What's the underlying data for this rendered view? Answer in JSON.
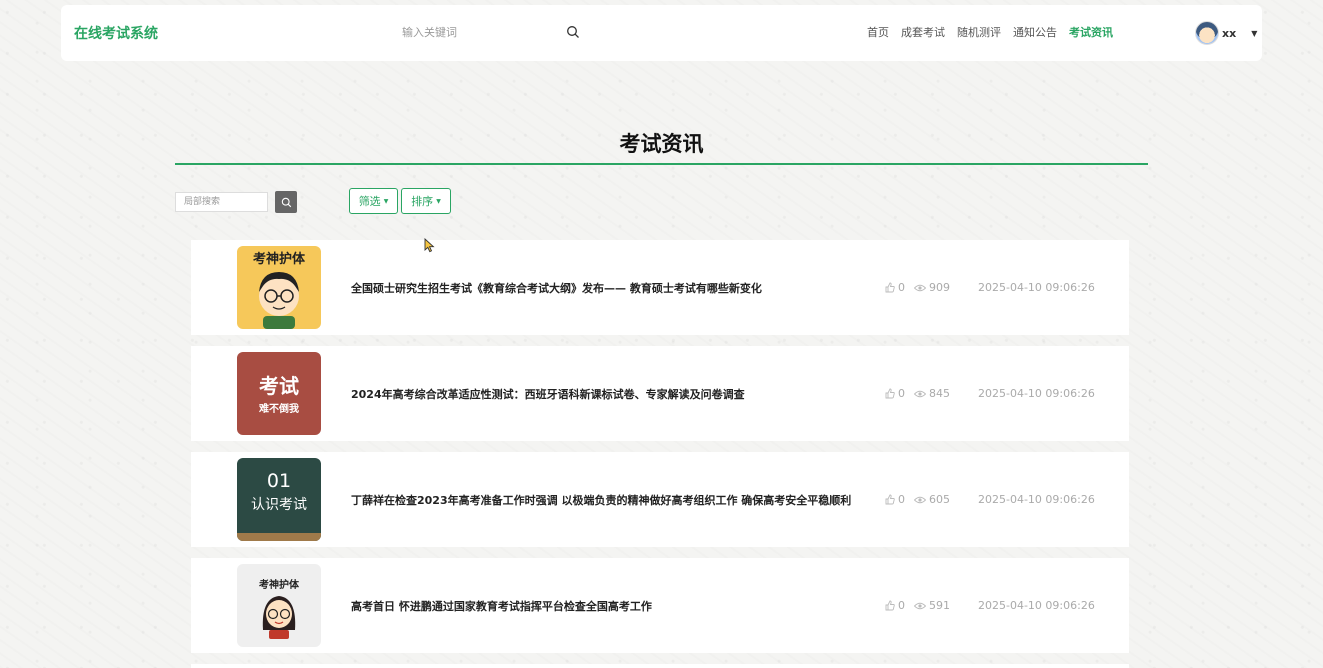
{
  "header": {
    "brand": "在线考试系统",
    "search_placeholder": "输入关键词",
    "nav": [
      "首页",
      "成套考试",
      "随机测评",
      "通知公告",
      "考试资讯"
    ],
    "active_nav": "考试资讯",
    "username": "xx"
  },
  "page": {
    "title": "考试资讯",
    "local_search_placeholder": "局部搜索",
    "filter_label": "筛选",
    "sort_label": "排序"
  },
  "news": [
    {
      "title": "全国硕士研究生招生考试《教育综合考试大纲》发布—— 教育硕士考试有哪些新变化",
      "likes": "0",
      "views": "909",
      "date": "2025-04-10 09:06:26",
      "thumb_text": "考神护体"
    },
    {
      "title": "2024年高考综合改革适应性测试：西班牙语科新课标试卷、专家解读及问卷调查",
      "likes": "0",
      "views": "845",
      "date": "2025-04-10 09:06:26",
      "thumb_text": "考试",
      "thumb_subtext": "难不倒我"
    },
    {
      "title": "丁薛祥在检查2023年高考准备工作时强调 以极端负责的精神做好高考组织工作 确保高考安全平稳顺利",
      "likes": "0",
      "views": "605",
      "date": "2025-04-10 09:06:26",
      "thumb_text": "01",
      "thumb_subtext": "认识考试"
    },
    {
      "title": "高考首日 怀进鹏通过国家教育考试指挥平台检查全国高考工作",
      "likes": "0",
      "views": "591",
      "date": "2025-04-10 09:06:26",
      "thumb_text": "考神护体"
    }
  ],
  "colors": {
    "accent": "#2aa563"
  }
}
